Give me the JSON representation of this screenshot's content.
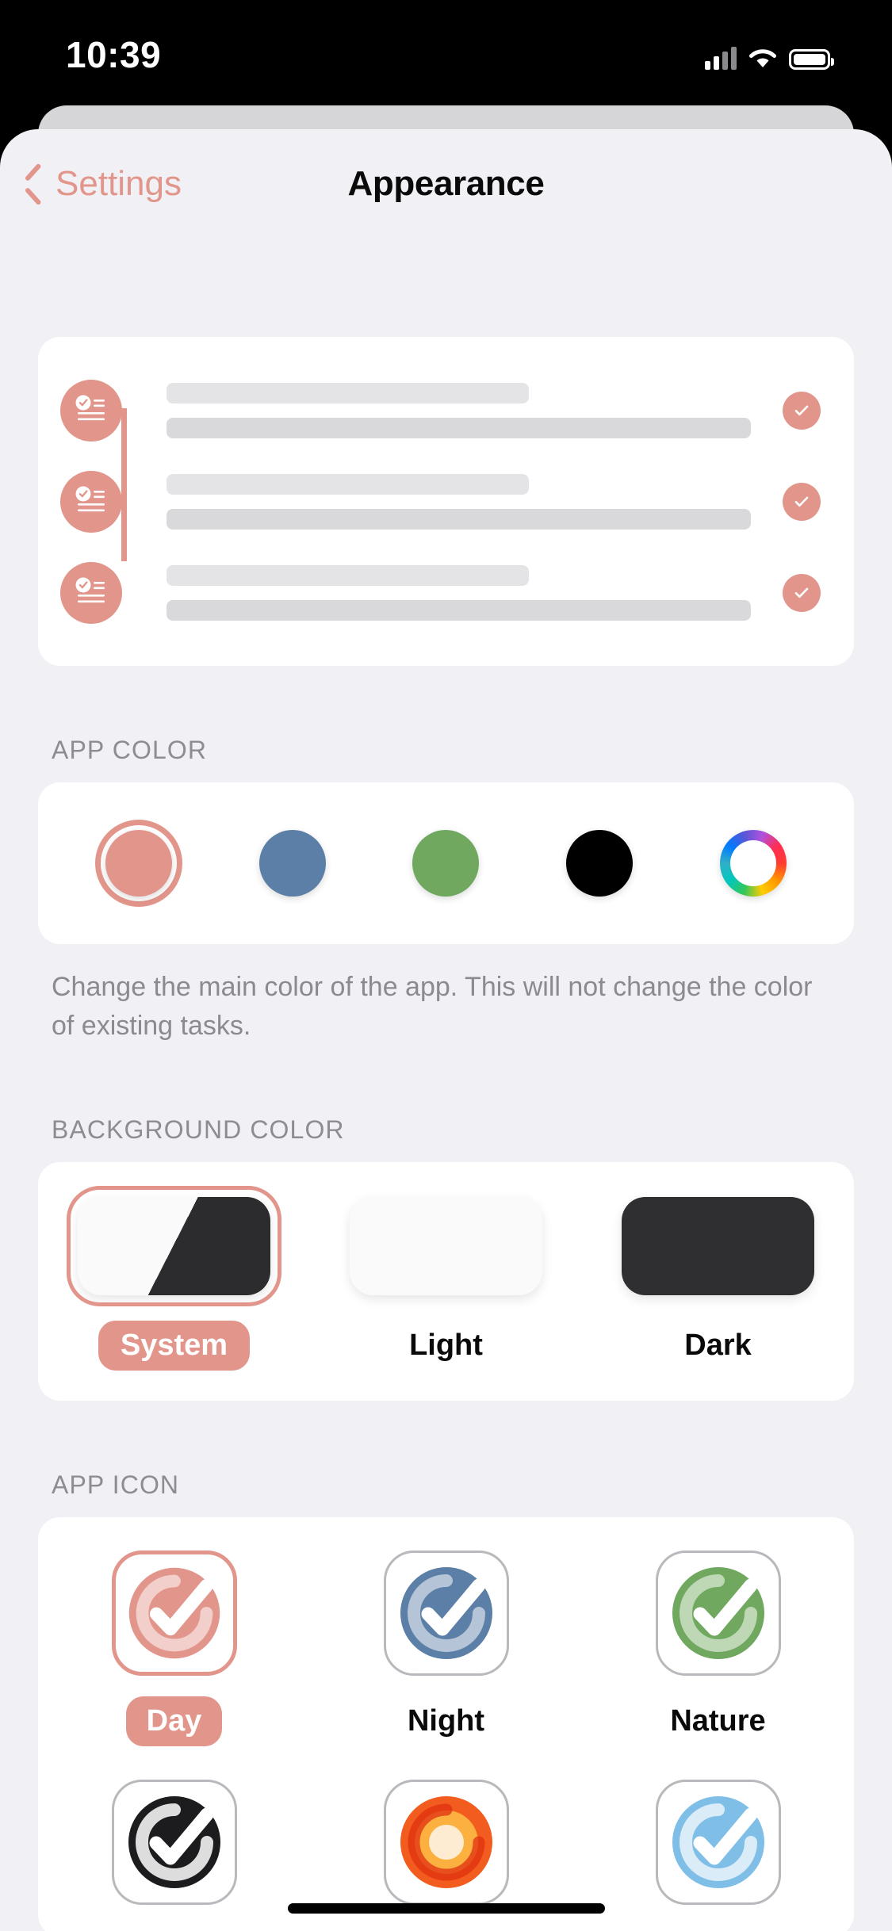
{
  "status_bar": {
    "time": "10:39",
    "cellular_icon": "signal-bars-icon",
    "wifi_icon": "wifi-icon",
    "battery_icon": "battery-icon"
  },
  "nav": {
    "back_label": "Settings",
    "back_icon": "chevron-left-icon",
    "title": "Appearance",
    "accent_color": "#E2958B"
  },
  "preview": {
    "rows": [
      {
        "avatar_icon": "checklist-icon",
        "check_icon": "check-icon"
      },
      {
        "avatar_icon": "checklist-icon",
        "check_icon": "check-icon"
      },
      {
        "avatar_icon": "checklist-icon",
        "check_icon": "check-icon"
      }
    ]
  },
  "app_color": {
    "label": "APP COLOR",
    "note": "Change the main color of the app. This will not change the color of existing tasks.",
    "swatches": [
      {
        "name": "salmon",
        "hex": "#E2958B",
        "selected": true
      },
      {
        "name": "blue",
        "hex": "#5B7FA6",
        "selected": false
      },
      {
        "name": "green",
        "hex": "#6FA85E",
        "selected": false
      },
      {
        "name": "black",
        "hex": "#000000",
        "selected": false
      },
      {
        "name": "rainbow",
        "hex": "rainbow",
        "selected": false
      }
    ]
  },
  "background_color": {
    "label": "BACKGROUND COLOR",
    "options": [
      {
        "label": "System",
        "selected": true
      },
      {
        "label": "Light",
        "selected": false
      },
      {
        "label": "Dark",
        "selected": false
      }
    ]
  },
  "app_icon": {
    "label": "APP ICON",
    "row1": [
      {
        "label": "Day",
        "hex": "#E2958B",
        "selected": true
      },
      {
        "label": "Night",
        "hex": "#5B7FA6",
        "selected": false
      },
      {
        "label": "Nature",
        "hex": "#6FA85E",
        "selected": false
      }
    ],
    "row2": [
      {
        "label": "",
        "hex": "#1C1C1E",
        "selected": false
      },
      {
        "label": "",
        "hex": "#F25C1F",
        "selected": false
      },
      {
        "label": "",
        "hex": "#7FBEE6",
        "selected": false
      }
    ]
  }
}
